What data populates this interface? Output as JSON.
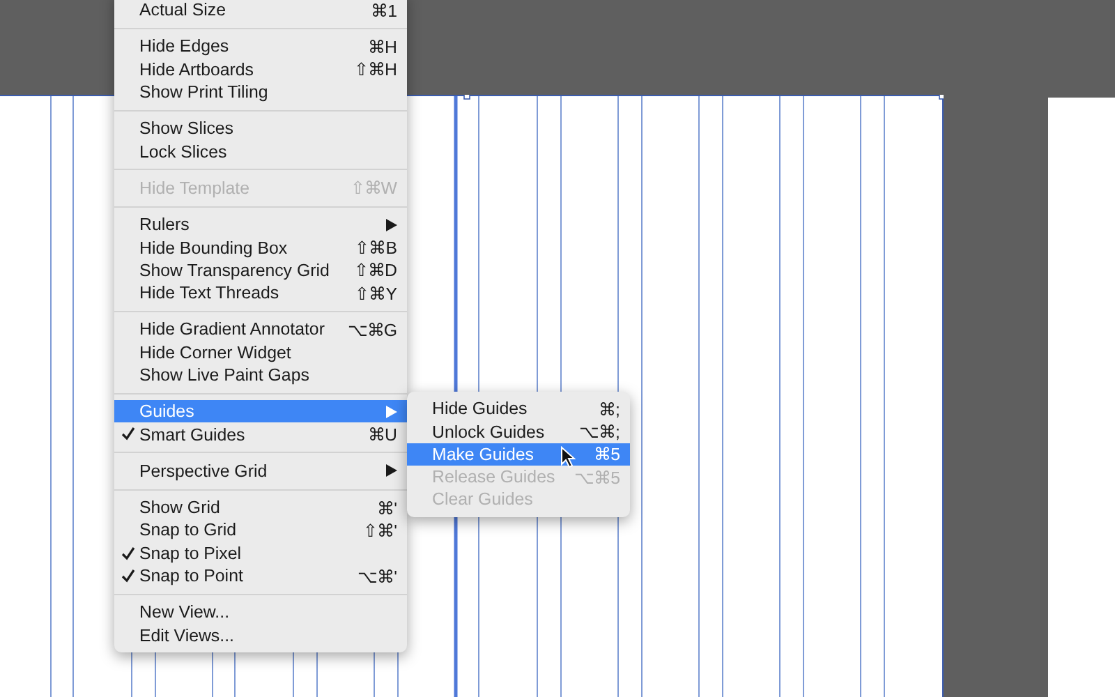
{
  "view_menu": {
    "items": [
      {
        "kind": "item",
        "label": "Actual Size",
        "shortcut": "⌘1",
        "checked": false,
        "disabled": false,
        "selected": false
      },
      {
        "kind": "separator"
      },
      {
        "kind": "item",
        "label": "Hide Edges",
        "shortcut": "⌘H",
        "checked": false,
        "disabled": false,
        "selected": false
      },
      {
        "kind": "item",
        "label": "Hide Artboards",
        "shortcut": "⇧⌘H",
        "checked": false,
        "disabled": false,
        "selected": false
      },
      {
        "kind": "item",
        "label": "Show Print Tiling",
        "checked": false,
        "disabled": false,
        "selected": false
      },
      {
        "kind": "separator"
      },
      {
        "kind": "item",
        "label": "Show Slices",
        "checked": false,
        "disabled": false,
        "selected": false
      },
      {
        "kind": "item",
        "label": "Lock Slices",
        "checked": false,
        "disabled": false,
        "selected": false
      },
      {
        "kind": "separator"
      },
      {
        "kind": "item",
        "label": "Hide Template",
        "shortcut": "⇧⌘W",
        "checked": false,
        "disabled": true,
        "selected": false
      },
      {
        "kind": "separator"
      },
      {
        "kind": "submenu",
        "label": "Rulers",
        "checked": false,
        "disabled": false,
        "selected": false
      },
      {
        "kind": "item",
        "label": "Hide Bounding Box",
        "shortcut": "⇧⌘B",
        "checked": false,
        "disabled": false,
        "selected": false
      },
      {
        "kind": "item",
        "label": "Show Transparency Grid",
        "shortcut": "⇧⌘D",
        "checked": false,
        "disabled": false,
        "selected": false
      },
      {
        "kind": "item",
        "label": "Hide Text Threads",
        "shortcut": "⇧⌘Y",
        "checked": false,
        "disabled": false,
        "selected": false
      },
      {
        "kind": "separator"
      },
      {
        "kind": "item",
        "label": "Hide Gradient Annotator",
        "shortcut": "⌥⌘G",
        "checked": false,
        "disabled": false,
        "selected": false
      },
      {
        "kind": "item",
        "label": "Hide Corner Widget",
        "checked": false,
        "disabled": false,
        "selected": false
      },
      {
        "kind": "item",
        "label": "Show Live Paint Gaps",
        "checked": false,
        "disabled": false,
        "selected": false
      },
      {
        "kind": "separator"
      },
      {
        "kind": "submenu",
        "label": "Guides",
        "checked": false,
        "disabled": false,
        "selected": true,
        "expanded": true,
        "children": [
          {
            "label": "Hide Guides",
            "shortcut": "⌘;",
            "disabled": false,
            "selected": false
          },
          {
            "label": "Unlock Guides",
            "shortcut": "⌥⌘;",
            "disabled": false,
            "selected": false
          },
          {
            "label": "Make Guides",
            "shortcut": "⌘5",
            "disabled": false,
            "selected": true
          },
          {
            "label": "Release Guides",
            "shortcut": "⌥⌘5",
            "disabled": true,
            "selected": false
          },
          {
            "label": "Clear Guides",
            "disabled": true,
            "selected": false
          }
        ]
      },
      {
        "kind": "item",
        "label": "Smart Guides",
        "shortcut": "⌘U",
        "checked": true,
        "disabled": false,
        "selected": false
      },
      {
        "kind": "separator"
      },
      {
        "kind": "submenu",
        "label": "Perspective Grid",
        "checked": false,
        "disabled": false,
        "selected": false
      },
      {
        "kind": "separator"
      },
      {
        "kind": "item",
        "label": "Show Grid",
        "shortcut": "⌘'",
        "checked": false,
        "disabled": false,
        "selected": false
      },
      {
        "kind": "item",
        "label": "Snap to Grid",
        "shortcut": "⇧⌘'",
        "checked": false,
        "disabled": false,
        "selected": false
      },
      {
        "kind": "item",
        "label": "Snap to Pixel",
        "checked": true,
        "disabled": false,
        "selected": false
      },
      {
        "kind": "item",
        "label": "Snap to Point",
        "shortcut": "⌥⌘'",
        "checked": true,
        "disabled": false,
        "selected": false
      },
      {
        "kind": "separator"
      },
      {
        "kind": "item",
        "label": "New View...",
        "checked": false,
        "disabled": false,
        "selected": false
      },
      {
        "kind": "item",
        "label": "Edit Views...",
        "checked": false,
        "disabled": false,
        "selected": false
      }
    ]
  }
}
